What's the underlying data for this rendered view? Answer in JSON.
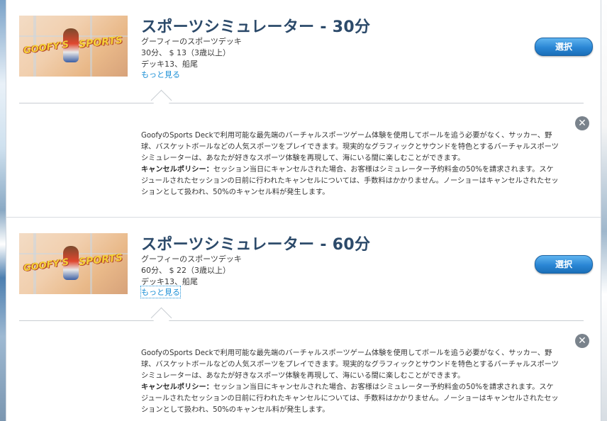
{
  "cards": [
    {
      "title": "スポーツシミュレーター - 30分",
      "venue": "グーフィーのスポーツデッキ",
      "duration_price": "30分、 $ 13（3歳以上）",
      "location": "デッキ13、船尾",
      "more_link": "もっと見る",
      "select_label": "選択",
      "close_glyph": "✕",
      "description": "GoofyのSports Deckで利用可能な最先端のバーチャルスポーツゲーム体験を使用してボールを追う必要がなく、サッカー、野球、バスケットボールなどの人気スポーツをプレイできます。現実的なグラフィックとサウンドを特色とするバーチャルスポーツシミュレーターは、あなたが好きなスポーツ体験を再現して、海にいる間に楽しむことができます。",
      "policy_label": "キャンセルポリシー：",
      "policy_text": "セッション当日にキャンセルされた場合、お客様はシミュレーター予約料金の50%を請求されます。スケジュールされたセッションの日前に行われたキャンセルについては、手数料はかかりません。ノーショーはキャンセルされたセッションとして扱われ、50%のキャンセル料が発生します。",
      "thumb_logo_left": "GOOFY'S",
      "thumb_logo_right": "SPORTS"
    },
    {
      "title": "スポーツシミュレーター - 60分",
      "venue": "グーフィーのスポーツデッキ",
      "duration_price": "60分、 $ 22（3歳以上）",
      "location": "デッキ13、船尾",
      "more_link": "もっと見る",
      "select_label": "選択",
      "close_glyph": "✕",
      "description": "GoofyのSports Deckで利用可能な最先端のバーチャルスポーツゲーム体験を使用してボールを追う必要がなく、サッカー、野球、バスケットボールなどの人気スポーツをプレイできます。現実的なグラフィックとサウンドを特色とするバーチャルスポーツシミュレーターは、あなたが好きなスポーツ体験を再現して、海にいる間に楽しむことができます。",
      "policy_label": "キャンセルポリシー：",
      "policy_text": "セッション当日にキャンセルされた場合、お客様はシミュレーター予約料金の50%を請求されます。スケジュールされたセッションの日前に行われたキャンセルについては、手数料はかかりません。ノーショーはキャンセルされたセッションとして扱われ、50%のキャンセル料が発生します。",
      "thumb_logo_left": "GOOFY'S",
      "thumb_logo_right": "SPORTS"
    }
  ],
  "colors": {
    "title": "#2c4a6a",
    "link": "#1a8fd6",
    "button": "#2a86d4",
    "close": "#7a838c"
  }
}
